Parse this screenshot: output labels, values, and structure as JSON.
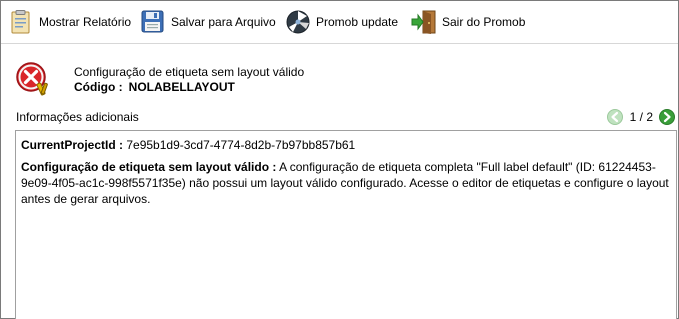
{
  "toolbar": {
    "show_report": {
      "label": "Mostrar Relatório",
      "icon": "report-clipboard-icon"
    },
    "save_file": {
      "label": "Salvar para Arquivo",
      "icon": "floppy-disk-icon"
    },
    "update": {
      "label": "Promob update",
      "icon": "update-globe-icon"
    },
    "exit": {
      "label": "Sair do Promob",
      "icon": "exit-door-icon"
    }
  },
  "message": {
    "icon": "error-x-icon",
    "title": "Configuração de etiqueta sem layout válido",
    "code_label": "Código :",
    "code_value": "NOLABELLAYOUT"
  },
  "info": {
    "label": "Informações adicionais",
    "pager": {
      "count": "1 / 2",
      "prev_icon": "arrow-left-icon",
      "next_icon": "arrow-right-icon"
    }
  },
  "details": {
    "project_label": "CurrentProjectId :",
    "project_value": "7e95b1d9-3cd7-4774-8d2b-7b97bb857b61",
    "config_label": "Configuração de etiqueta sem layout válido :",
    "config_text": "A configuração de etiqueta completa \"Full label default\" (ID: 61224453-9e09-4f05-ac1c-998f5571f35e) não possui um layout válido configurado. Acesse o editor de etiquetas e configure o layout antes de gerar arquivos."
  },
  "colors": {
    "error_red": "#d9262a",
    "nav_green": "#3a9e3a",
    "border": "#a0a0a0"
  }
}
